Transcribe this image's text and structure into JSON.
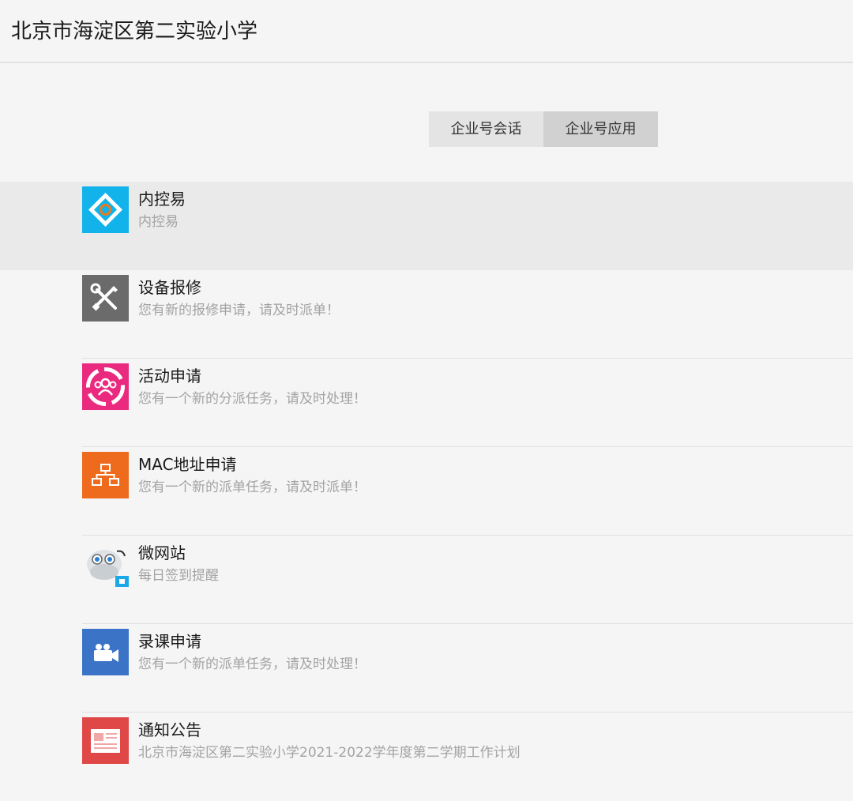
{
  "header": {
    "title": "北京市海淀区第二实验小学"
  },
  "tabs": [
    {
      "label": "企业号会话",
      "active": false
    },
    {
      "label": "企业号应用",
      "active": true
    }
  ],
  "apps": [
    {
      "name": "内控易",
      "desc": "内控易",
      "icon": "diamond-logo-icon",
      "color": "#1aa8e6"
    },
    {
      "name": "设备报修",
      "desc": "您有新的报修申请，请及时派单！",
      "icon": "wrench-screwdriver-icon",
      "color": "#6b6b6b"
    },
    {
      "name": "活动申请",
      "desc": "您有一个新的分派任务，请及时处理！",
      "icon": "group-people-icon",
      "color": "#e92a7e"
    },
    {
      "name": "MAC地址申请",
      "desc": "您有一个新的派单任务，请及时派单！",
      "icon": "network-tree-icon",
      "color": "#ee6a1c"
    },
    {
      "name": "微网站",
      "desc": "每日签到提醒",
      "icon": "robot-avatar-icon",
      "color": "#1aa8e6"
    },
    {
      "name": "录课申请",
      "desc": "您有一个新的派单任务，请及时处理！",
      "icon": "video-camera-icon",
      "color": "#3b73c6"
    },
    {
      "name": "通知公告",
      "desc": "北京市海淀区第二实验小学2021-2022学年度第二学期工作计划",
      "icon": "newspaper-icon",
      "color": "#e04848"
    }
  ]
}
